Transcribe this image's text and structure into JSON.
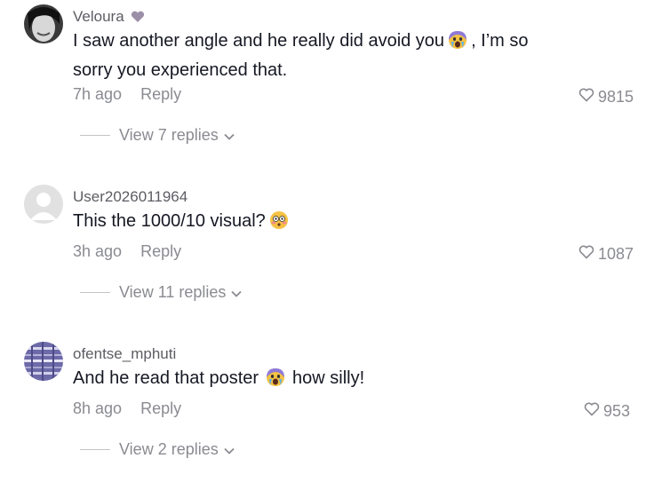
{
  "comments": [
    {
      "username": "Veloura",
      "username_badge": "purple-heart-emoji",
      "text_before": "I saw another angle and he really did avoid you",
      "text_emoji": "crying-emoji",
      "text_after": ", I’m so sorry you experienced that.",
      "time": "7h ago",
      "reply_label": "Reply",
      "likes": "9815",
      "view_replies": "View 7 replies"
    },
    {
      "username": "User2026011964",
      "text_before": "This the 1000/10 visual?",
      "text_emoji": "flushed-emoji",
      "text_after": "",
      "time": "3h ago",
      "reply_label": "Reply",
      "likes": "1087",
      "view_replies": "View 11 replies"
    },
    {
      "username": "ofentse_mphuti",
      "text_before": "And he read that poster",
      "text_emoji": "crying-emoji",
      "text_after": "how silly!",
      "time": "8h ago",
      "reply_label": "Reply",
      "likes": "953",
      "view_replies": "View 2 replies"
    }
  ],
  "colors": {
    "text": "#161823",
    "muted": "#8a8b91",
    "username": "#5c5c63"
  }
}
